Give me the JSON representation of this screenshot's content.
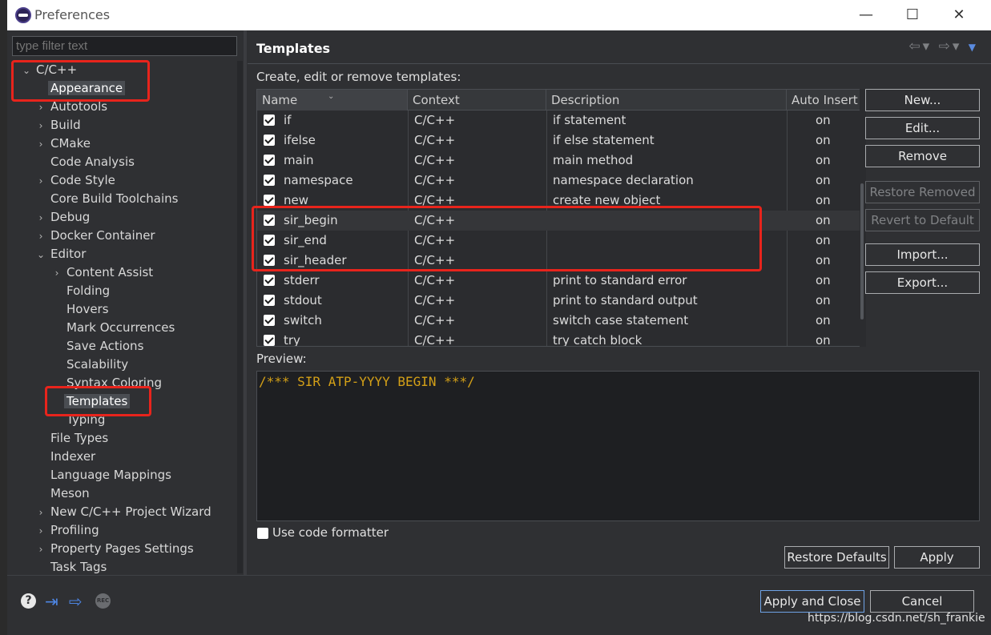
{
  "window": {
    "title": "Preferences",
    "controls": {
      "minimize": "—",
      "maximize": "☐",
      "close": "✕"
    }
  },
  "sidebar": {
    "filter_placeholder": "type filter text",
    "items": [
      {
        "label": "C/C++",
        "arrow": "⌄"
      },
      {
        "label": "Appearance",
        "arrow": ""
      },
      {
        "label": "Autotools",
        "arrow": "›"
      },
      {
        "label": "Build",
        "arrow": "›"
      },
      {
        "label": "CMake",
        "arrow": "›"
      },
      {
        "label": "Code Analysis",
        "arrow": ""
      },
      {
        "label": "Code Style",
        "arrow": "›"
      },
      {
        "label": "Core Build Toolchains",
        "arrow": ""
      },
      {
        "label": "Debug",
        "arrow": "›"
      },
      {
        "label": "Docker Container",
        "arrow": "›"
      },
      {
        "label": "Editor",
        "arrow": "⌄"
      },
      {
        "label": "Content Assist",
        "arrow": "›"
      },
      {
        "label": "Folding",
        "arrow": ""
      },
      {
        "label": "Hovers",
        "arrow": ""
      },
      {
        "label": "Mark Occurrences",
        "arrow": ""
      },
      {
        "label": "Save Actions",
        "arrow": ""
      },
      {
        "label": "Scalability",
        "arrow": ""
      },
      {
        "label": "Syntax Coloring",
        "arrow": ""
      },
      {
        "label": "Templates",
        "arrow": ""
      },
      {
        "label": "Typing",
        "arrow": ""
      },
      {
        "label": "File Types",
        "arrow": ""
      },
      {
        "label": "Indexer",
        "arrow": ""
      },
      {
        "label": "Language Mappings",
        "arrow": ""
      },
      {
        "label": "Meson",
        "arrow": ""
      },
      {
        "label": "New C/C++ Project Wizard",
        "arrow": "›"
      },
      {
        "label": "Profiling",
        "arrow": "›"
      },
      {
        "label": "Property Pages Settings",
        "arrow": "›"
      },
      {
        "label": "Task Tags",
        "arrow": ""
      }
    ]
  },
  "page": {
    "title": "Templates",
    "nav": {
      "back": "⇦",
      "back_menu": "▾",
      "forward": "⇨",
      "forward_menu": "▾",
      "view_menu": "▼"
    },
    "subtitle": "Create, edit or remove templates:"
  },
  "table": {
    "columns": [
      "Name",
      "Context",
      "Description",
      "Auto Insert"
    ],
    "sort_icon": "⌄",
    "rows": [
      {
        "name": "if",
        "context": "C/C++",
        "description": "if statement",
        "auto": "on"
      },
      {
        "name": "ifelse",
        "context": "C/C++",
        "description": "if else statement",
        "auto": "on"
      },
      {
        "name": "main",
        "context": "C/C++",
        "description": "main method",
        "auto": "on"
      },
      {
        "name": "namespace",
        "context": "C/C++",
        "description": "namespace declaration",
        "auto": "on"
      },
      {
        "name": "new",
        "context": "C/C++",
        "description": "create new object",
        "auto": "on"
      },
      {
        "name": "sir_begin",
        "context": "C/C++",
        "description": "",
        "auto": "on"
      },
      {
        "name": "sir_end",
        "context": "C/C++",
        "description": "",
        "auto": "on"
      },
      {
        "name": "sir_header",
        "context": "C/C++",
        "description": "",
        "auto": "on"
      },
      {
        "name": "stderr",
        "context": "C/C++",
        "description": "print to standard error",
        "auto": "on"
      },
      {
        "name": "stdout",
        "context": "C/C++",
        "description": "print to standard output",
        "auto": "on"
      },
      {
        "name": "switch",
        "context": "C/C++",
        "description": "switch case statement",
        "auto": "on"
      },
      {
        "name": "try",
        "context": "C/C++",
        "description": "try catch block",
        "auto": "on"
      }
    ]
  },
  "buttons": {
    "new": "New...",
    "edit": "Edit...",
    "remove": "Remove",
    "restore_removed": "Restore Removed",
    "revert_default": "Revert to Default",
    "import": "Import...",
    "export": "Export...",
    "restore_defaults": "Restore Defaults",
    "apply": "Apply",
    "apply_close": "Apply and Close",
    "cancel": "Cancel"
  },
  "preview": {
    "label": "Preview:",
    "code": "/*** SIR ATP-YYYY BEGIN ***/"
  },
  "formatter": {
    "label": "Use code formatter"
  },
  "footer": {
    "help": "?",
    "import_icon": "⇥",
    "export_icon": "⇨",
    "rec": "REC"
  },
  "watermark": "https://blog.csdn.net/sh_frankie"
}
